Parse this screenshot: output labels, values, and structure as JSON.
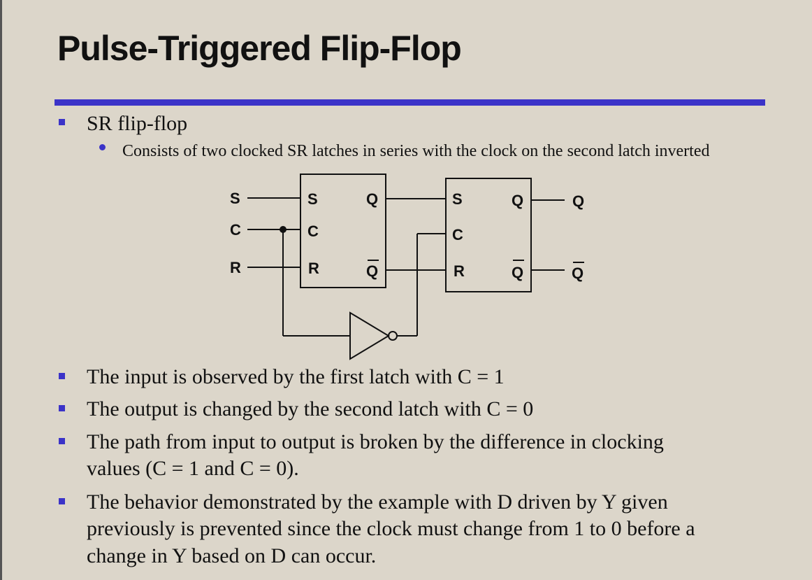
{
  "slide": {
    "title": "Pulse-Triggered Flip-Flop",
    "accent_color": "#3b33c8",
    "bullets": [
      {
        "text": "SR flip-flop"
      }
    ],
    "sub_bullets": [
      {
        "text": "Consists of two clocked SR latches in series with the clock on the second latch inverted"
      }
    ],
    "points": [
      "The input is observed by the first latch with C = 1",
      "The output is changed by the second latch with C = 0",
      "The path from input to output is broken by the difference in clocking",
      "values (C = 1 and C = 0).",
      "The behavior demonstrated by the example with D driven by Y given",
      "previously is prevented since the clock must change from 1 to 0 before a",
      "change in Y based on D can occur."
    ]
  },
  "diagram": {
    "inputs": {
      "s": "S",
      "c": "C",
      "r": "R"
    },
    "latch1": {
      "s": "S",
      "c": "C",
      "r": "R",
      "q": "Q",
      "qbar": "Q"
    },
    "latch2": {
      "s": "S",
      "c": "C",
      "r": "R",
      "q": "Q",
      "qbar": "Q"
    },
    "outputs": {
      "q": "Q",
      "qbar": "Q"
    }
  }
}
